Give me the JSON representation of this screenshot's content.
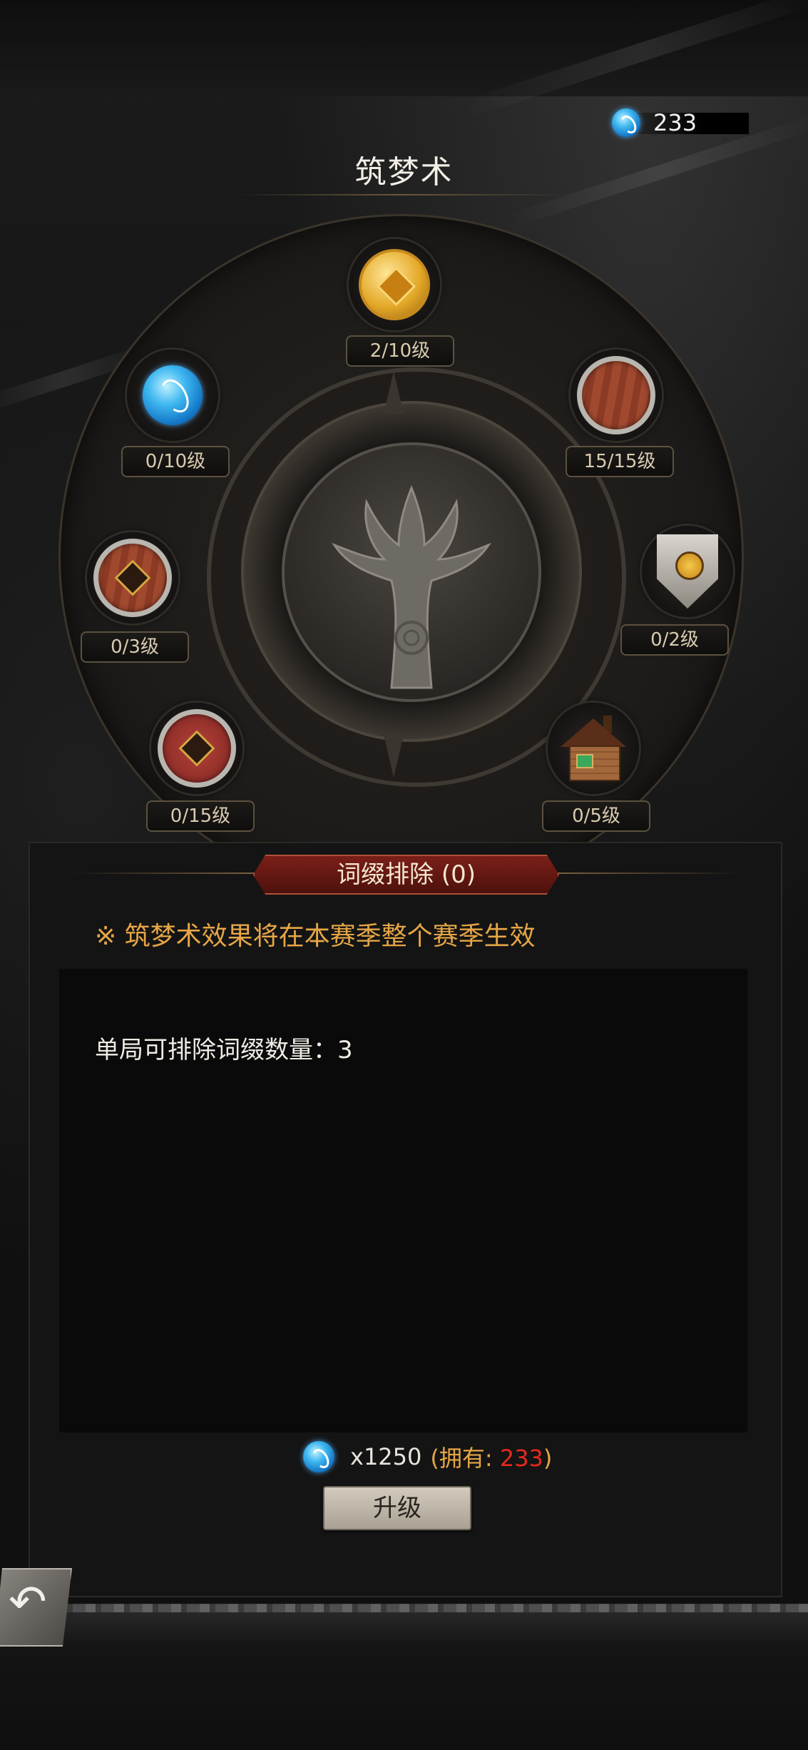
{
  "currency": {
    "amount": "233",
    "icon": "dream-gem-icon"
  },
  "header": {
    "title": "筑梦术"
  },
  "nodes": [
    {
      "id": "gold-coin",
      "icon": "gold-coin-icon",
      "level": "2/10级"
    },
    {
      "id": "blue-gem",
      "icon": "blue-gem-icon",
      "level": "0/10级"
    },
    {
      "id": "wood-shield",
      "icon": "wooden-shield-icon",
      "level": "15/15级"
    },
    {
      "id": "shield-emblem",
      "icon": "round-shield-emblem-icon",
      "level": "0/3级"
    },
    {
      "id": "heater-shield",
      "icon": "heater-shield-icon",
      "level": "0/2级"
    },
    {
      "id": "red-shield",
      "icon": "red-shield-emblem-icon",
      "level": "0/15级"
    },
    {
      "id": "house",
      "icon": "wooden-house-icon",
      "level": "0/5级"
    }
  ],
  "panel": {
    "banner": "词缀排除 (0)",
    "note": "※ 筑梦术效果将在本赛季整个赛季生效",
    "effect": "单局可排除词缀数量：3",
    "cost": {
      "amount": "x1250",
      "own_prefix": "(拥有: ",
      "own_value": "233",
      "own_suffix": ")"
    },
    "upgrade_label": "升级"
  },
  "colors": {
    "accent_gold": "#e6a646",
    "banner_red": "#7a1f18",
    "insufficient": "#e8281e"
  }
}
